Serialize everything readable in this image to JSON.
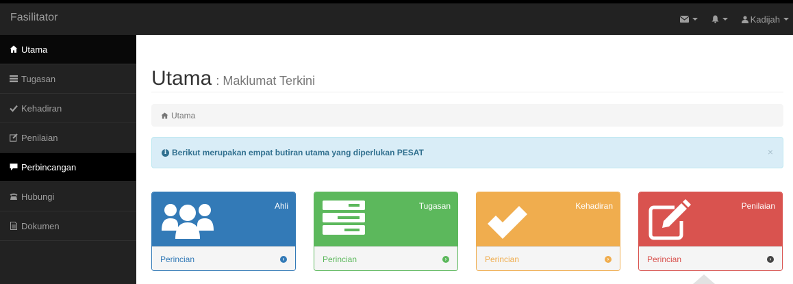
{
  "navbar": {
    "brand": "Fasilitator",
    "user_name": "Kadijah",
    "icons": [
      "envelope-icon",
      "bell-icon",
      "user-icon"
    ]
  },
  "sidebar": {
    "items": [
      {
        "label": "Utama",
        "icon": "home-icon"
      },
      {
        "label": "Tugasan",
        "icon": "tasks-icon"
      },
      {
        "label": "Kehadiran",
        "icon": "check-icon"
      },
      {
        "label": "Penilaian",
        "icon": "edit-icon"
      },
      {
        "label": "Perbincangan",
        "icon": "comment-icon"
      },
      {
        "label": "Hubungi",
        "icon": "phone-icon"
      },
      {
        "label": "Dokumen",
        "icon": "document-icon"
      }
    ]
  },
  "page": {
    "title": "Utama",
    "subtitle": ": Maklumat Terkini"
  },
  "breadcrumb": {
    "label": "Utama"
  },
  "alert": {
    "text": "Berikut merupakan empat butiran utama yang diperlukan PESAT",
    "close": "×"
  },
  "panels": [
    {
      "label": "Ahli",
      "link": "Perincian",
      "color": "#337ab7",
      "icon": "users-icon"
    },
    {
      "label": "Tugasan",
      "link": "Perincian",
      "color": "#5cb85c",
      "icon": "tasks-icon"
    },
    {
      "label": "Kehadiran",
      "link": "Perincian",
      "color": "#f0ad4e",
      "icon": "check-icon"
    },
    {
      "label": "Penilaian",
      "link": "Perincian",
      "color": "#d9534f",
      "icon": "edit-icon"
    }
  ]
}
